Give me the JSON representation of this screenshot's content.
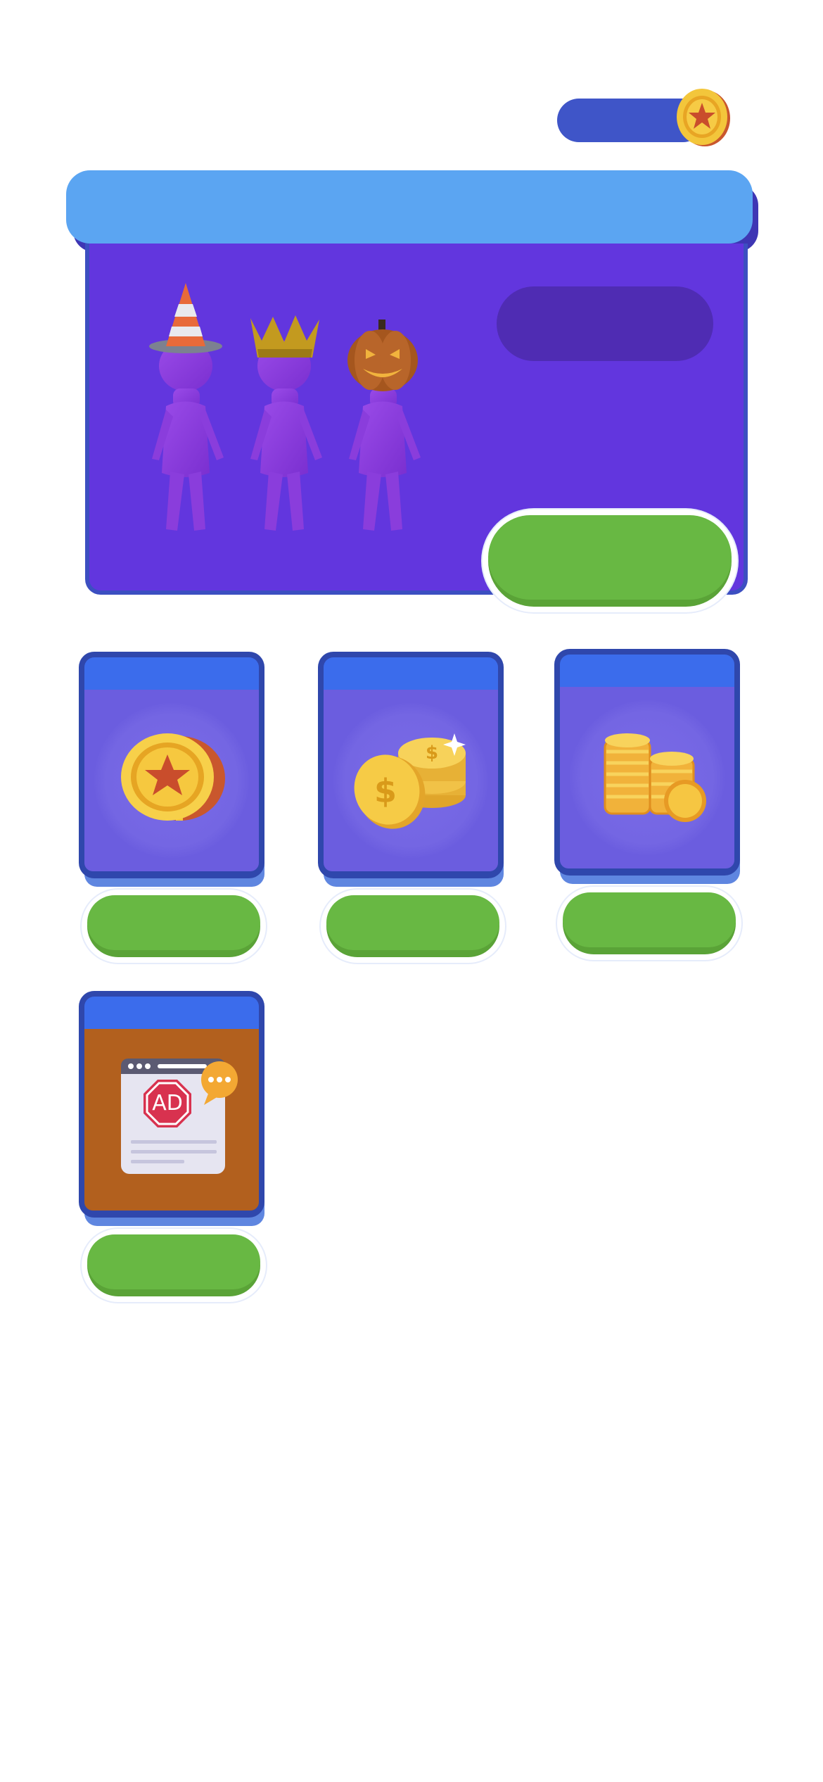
{
  "header": {
    "currency_amount": "",
    "currency_icon": "star-coin-icon"
  },
  "bundle": {
    "title": "",
    "badge_text": "",
    "buy_label": "",
    "items": [
      "traffic-cone-hat",
      "gold-crown",
      "pumpkin-head"
    ]
  },
  "products": [
    {
      "name": "star-coin",
      "caption": "",
      "buy_label": "",
      "icon": "star-coin-icon",
      "theme": "#6b5ddf"
    },
    {
      "name": "dollar-coins",
      "caption": "",
      "buy_label": "",
      "icon": "dollar-coins-icon",
      "theme": "#6b5ddf"
    },
    {
      "name": "coin-stacks",
      "caption": "",
      "buy_label": "",
      "icon": "coin-stack-icon",
      "theme": "#6b5ddf"
    },
    {
      "name": "remove-ads",
      "caption": "",
      "buy_label": "",
      "icon": "ad-block-icon",
      "theme": "#b2601e"
    }
  ],
  "colors": {
    "panel": "#6236de",
    "header": "#5ba5f2",
    "button": "#68b843",
    "card_cap": "#3b6cec"
  }
}
